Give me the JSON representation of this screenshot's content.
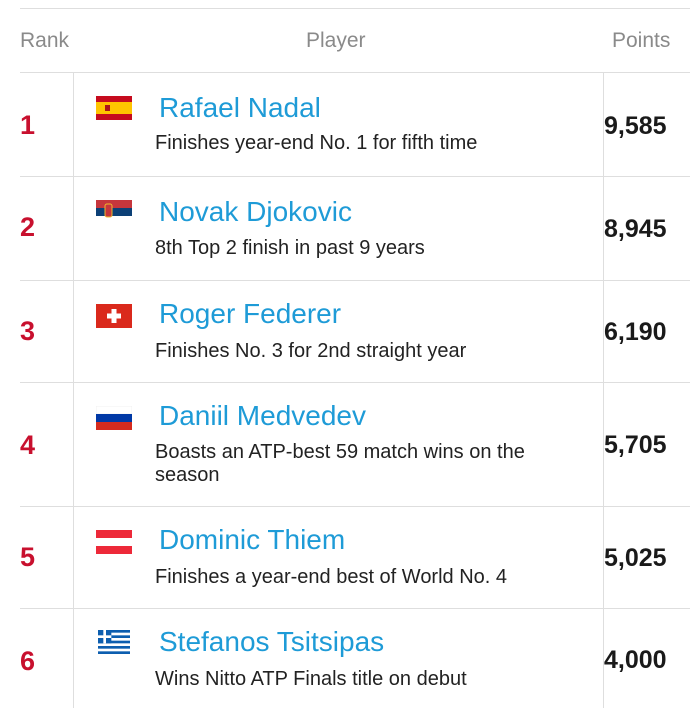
{
  "header": {
    "rank": "Rank",
    "player": "Player",
    "points": "Points"
  },
  "rows": [
    {
      "rank": "1",
      "flag": "spain-flag-icon",
      "name": "Rafael Nadal",
      "note": "Finishes year-end No. 1 for fifth time",
      "points": "9,585"
    },
    {
      "rank": "2",
      "flag": "serbia-flag-icon",
      "name": "Novak Djokovic",
      "note": "8th Top 2 finish in past 9 years",
      "points": "8,945"
    },
    {
      "rank": "3",
      "flag": "switzerland-flag-icon",
      "name": "Roger Federer",
      "note": "Finishes No. 3 for 2nd straight year",
      "points": "6,190"
    },
    {
      "rank": "4",
      "flag": "russia-flag-icon",
      "name": "Daniil Medvedev",
      "note": "Boasts an ATP-best 59 match wins on the season",
      "points": "5,705"
    },
    {
      "rank": "5",
      "flag": "austria-flag-icon",
      "name": "Dominic Thiem",
      "note": "Finishes a year-end best of World No. 4",
      "points": "5,025"
    },
    {
      "rank": "6",
      "flag": "greece-flag-icon",
      "name": "Stefanos Tsitsipas",
      "note": "Wins Nitto ATP Finals title on debut",
      "points": "4,000"
    }
  ],
  "colors": {
    "rank": "#c8102e",
    "name": "#1e9bd7",
    "divider": "#dedede"
  }
}
